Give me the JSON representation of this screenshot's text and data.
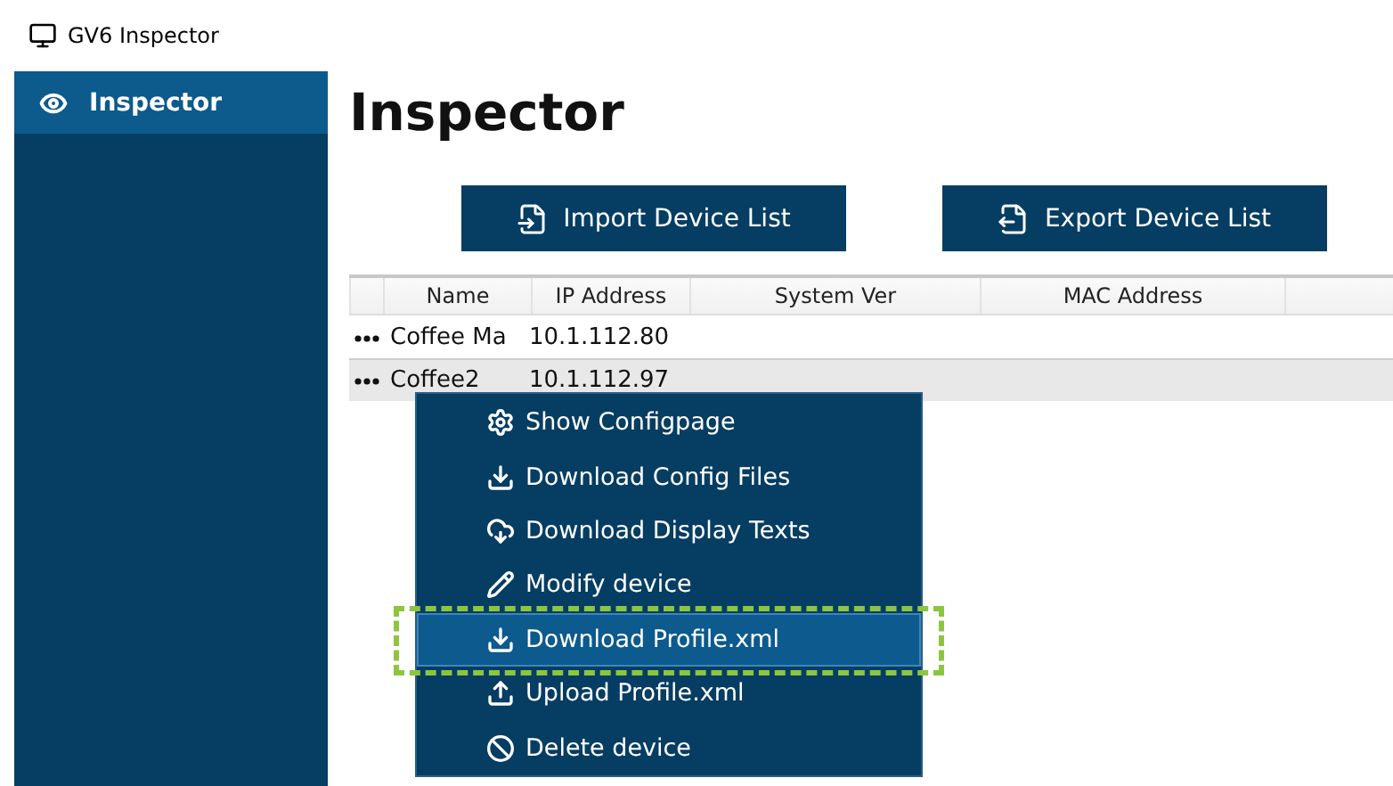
{
  "window": {
    "title": "GV6 Inspector"
  },
  "sidebar": {
    "items": [
      {
        "label": "Inspector",
        "selected": true
      }
    ]
  },
  "heading": "Inspector",
  "toolbar": {
    "buttons": [
      {
        "label": "Import Device List",
        "kind": "import"
      },
      {
        "label": "Export Device List",
        "kind": "export"
      }
    ]
  },
  "table": {
    "columns": [
      "",
      "Name",
      "IP Address",
      "System Ver",
      "MAC Address",
      ""
    ],
    "rows": [
      {
        "name": "Coffee Ma",
        "ip": "10.1.112.80",
        "selected": false
      },
      {
        "name": "Coffee2",
        "ip": "10.1.112.97",
        "selected": true
      }
    ]
  },
  "context_menu": {
    "items": [
      {
        "label": "Show Configpage",
        "kind": "settings",
        "selected": false,
        "callout": false
      },
      {
        "label": "Download Config Files",
        "kind": "download",
        "selected": false,
        "callout": false
      },
      {
        "label": "Download Display Texts",
        "kind": "cloud",
        "selected": false,
        "callout": false
      },
      {
        "label": "Modify device",
        "kind": "edit",
        "selected": false,
        "callout": false
      },
      {
        "label": "Download Profile.xml",
        "kind": "download",
        "selected": true,
        "callout": true
      },
      {
        "label": "Upload Profile.xml",
        "kind": "upload",
        "selected": false,
        "callout": false
      },
      {
        "label": "Delete device",
        "kind": "delete",
        "selected": false,
        "callout": false
      }
    ]
  }
}
